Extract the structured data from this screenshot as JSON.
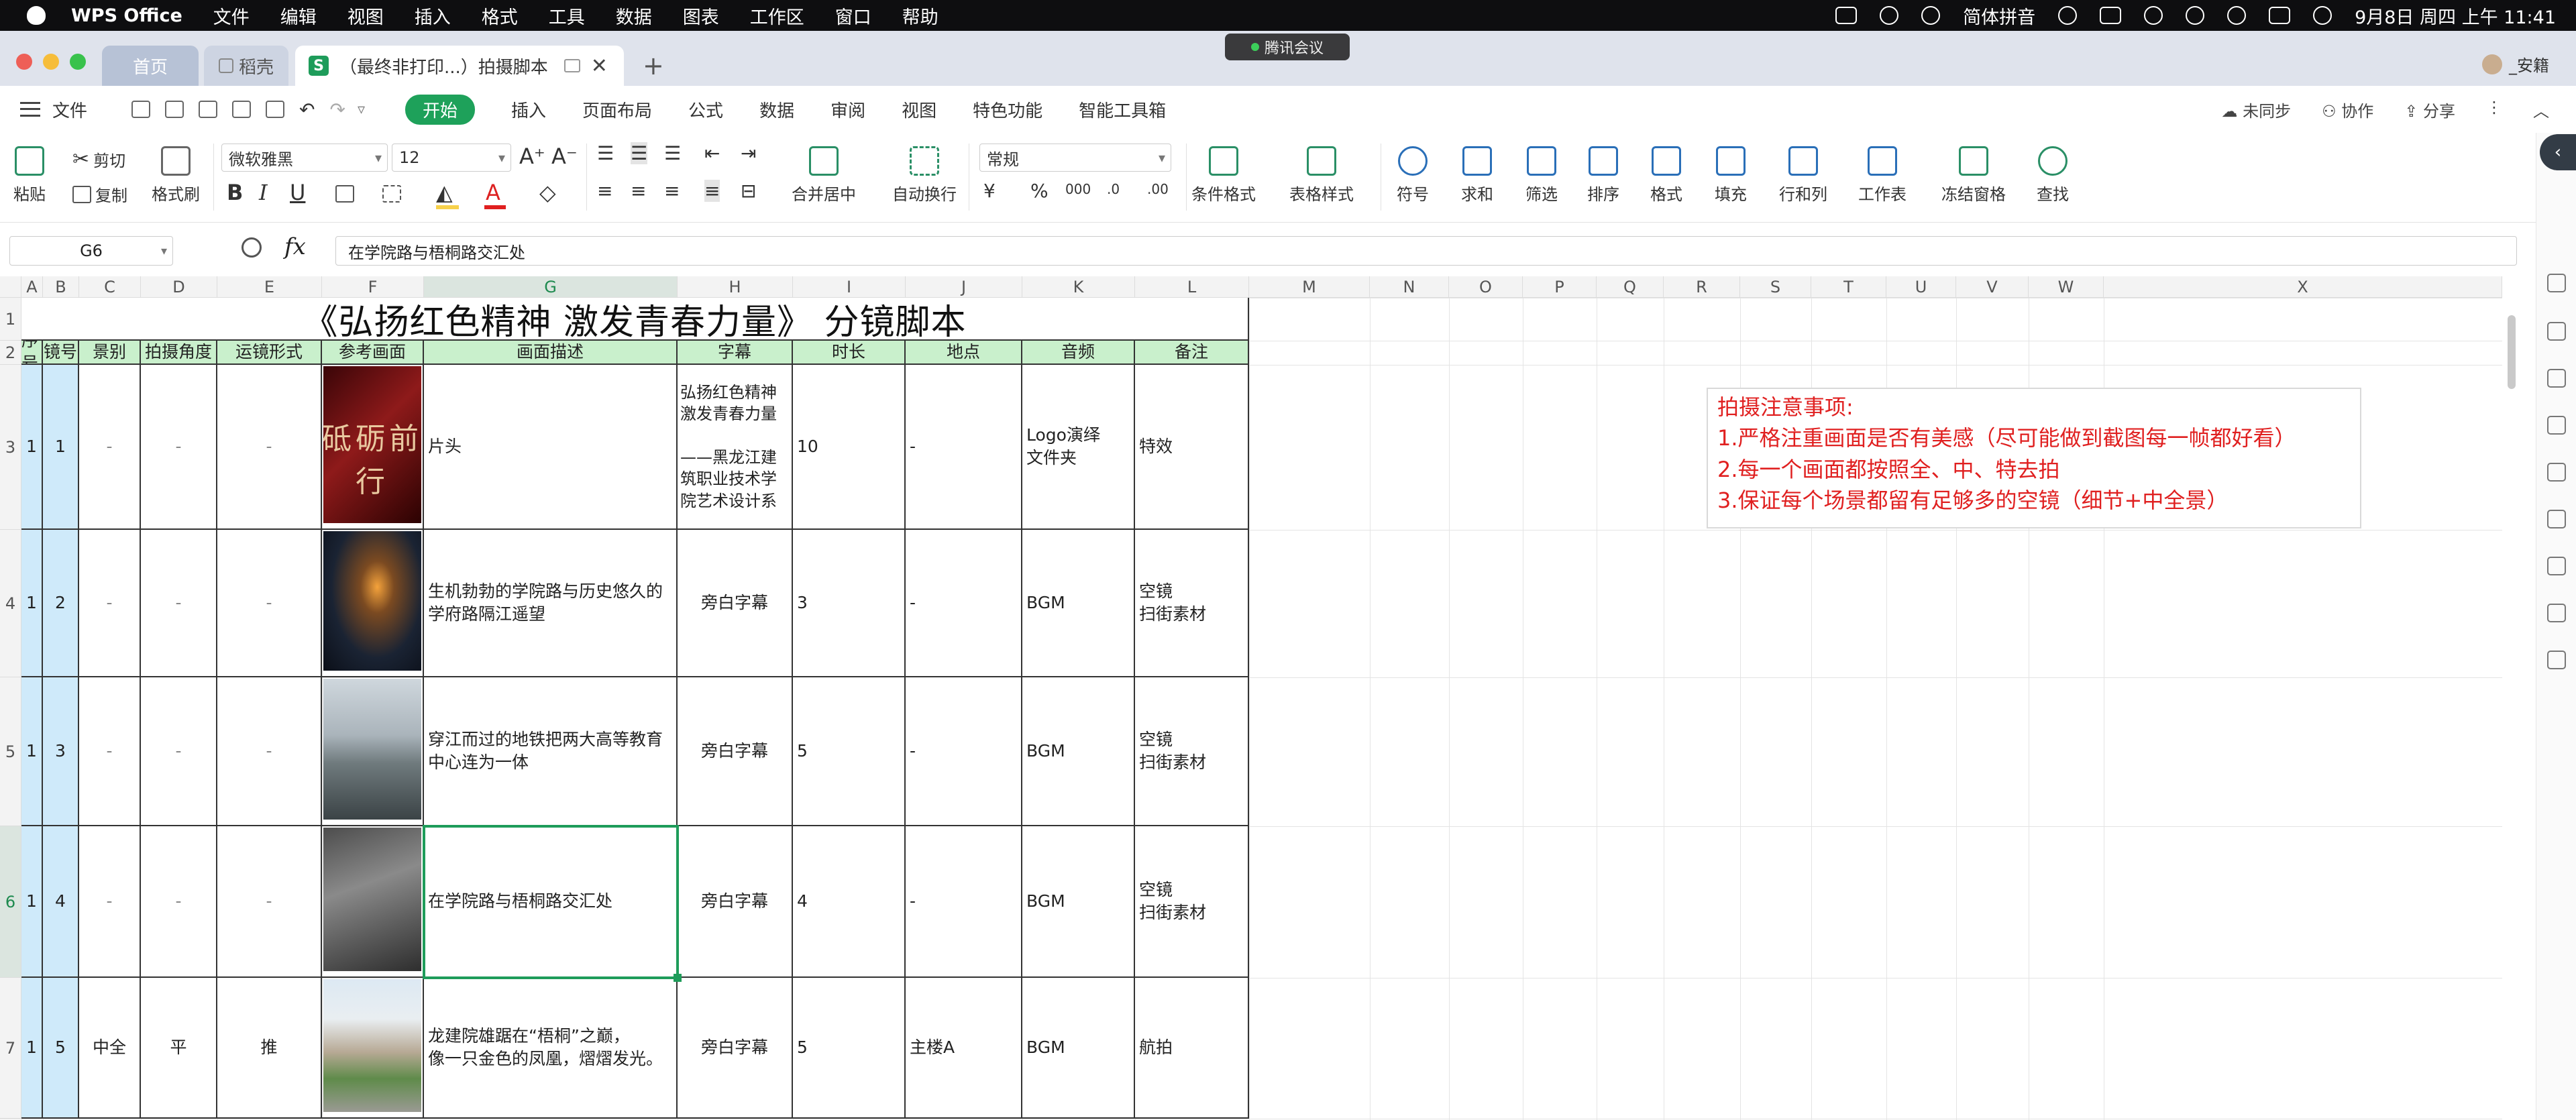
{
  "menubar": {
    "app": "WPS Office",
    "items": [
      "文件",
      "编辑",
      "视图",
      "插入",
      "格式",
      "工具",
      "数据",
      "图表",
      "工作区",
      "窗口",
      "帮助"
    ],
    "input_method": "简体拼音",
    "datetime": "9月8日 周四 上午 11:41"
  },
  "meeting": "腾讯会议",
  "tabs": {
    "home": "首页",
    "daoke": "稻壳",
    "doc": "（最终非打印...）拍摄脚本"
  },
  "user": "_安籍",
  "menurow": {
    "file": "文件",
    "tabs": [
      "开始",
      "插入",
      "页面布局",
      "公式",
      "数据",
      "审阅",
      "视图",
      "特色功能",
      "智能工具箱"
    ],
    "sync": "未同步",
    "collab": "协作",
    "share": "分享"
  },
  "ribbon": {
    "paste": "粘贴",
    "cut": "剪切",
    "copy": "复制",
    "format_painter": "格式刷",
    "font_name": "微软雅黑",
    "font_size": "12",
    "merge_center": "合并居中",
    "wrap_text": "自动换行",
    "number_format": "常规",
    "cond_format": "条件格式",
    "table_style": "表格样式",
    "symbol": "符号",
    "sum": "求和",
    "filter": "筛选",
    "sort": "排序",
    "format": "格式",
    "fill": "填充",
    "rowcol": "行和列",
    "sheet": "工作表",
    "freeze": "冻结窗格",
    "find": "查找"
  },
  "formula_bar": {
    "cell_ref": "G6",
    "fx": "fx",
    "content": "在学院路与梧桐路交汇处"
  },
  "columns": [
    "A",
    "B",
    "C",
    "D",
    "E",
    "F",
    "G",
    "H",
    "I",
    "J",
    "K",
    "L",
    "M",
    "N",
    "O",
    "P",
    "Q",
    "R",
    "S",
    "T",
    "U",
    "V",
    "W",
    "X"
  ],
  "rows": [
    "1",
    "2",
    "3",
    "4",
    "5",
    "6",
    "7"
  ],
  "sheet": {
    "title": "《弘扬红色精神  激发青春力量》 分镜脚本",
    "headers": [
      "序号",
      "镜号",
      "景别",
      "拍摄角度",
      "运镜形式",
      "参考画面",
      "画面描述",
      "字幕",
      "时长",
      "地点",
      "音频",
      "备注"
    ],
    "data": [
      [
        "1",
        "1",
        "-",
        "-",
        "-",
        "",
        "片头",
        "弘扬红色精神\n激发青春力量\n\n——黑龙江建筑职业技术学院艺术设计系",
        "10",
        "-",
        "Logo演绎\n文件夹",
        "特效"
      ],
      [
        "1",
        "2",
        "-",
        "-",
        "-",
        "",
        "生机勃勃的学院路与历史悠久的学府路隔江遥望",
        "旁白字幕",
        "3",
        "-",
        "BGM",
        "空镜\n扫街素材"
      ],
      [
        "1",
        "3",
        "-",
        "-",
        "-",
        "",
        "穿江而过的地铁把两大高等教育中心连为一体",
        "旁白字幕",
        "5",
        "-",
        "BGM",
        "空镜\n扫街素材"
      ],
      [
        "1",
        "4",
        "-",
        "-",
        "-",
        "",
        "在学院路与梧桐路交汇处",
        "旁白字幕",
        "4",
        "-",
        "BGM",
        "空镜\n扫街素材"
      ],
      [
        "1",
        "5",
        "中全",
        "平",
        "推",
        "",
        "龙建院雄踞在“梧桐”之巅，\n像一只金色的凤凰，熠熠发光。",
        "旁白字幕",
        "5",
        "主楼A",
        "BGM",
        "航拍"
      ]
    ],
    "thumb_caption": "砥砺前行"
  },
  "notes": {
    "title": "拍摄注意事项:",
    "items": [
      "1.严格注重画面是否有美感（尽可能做到截图每一帧都好看）",
      "2.每一个画面都按照全、中、特去拍",
      "3.保证每个场景都留有足够多的空镜（细节+中全景）"
    ]
  }
}
